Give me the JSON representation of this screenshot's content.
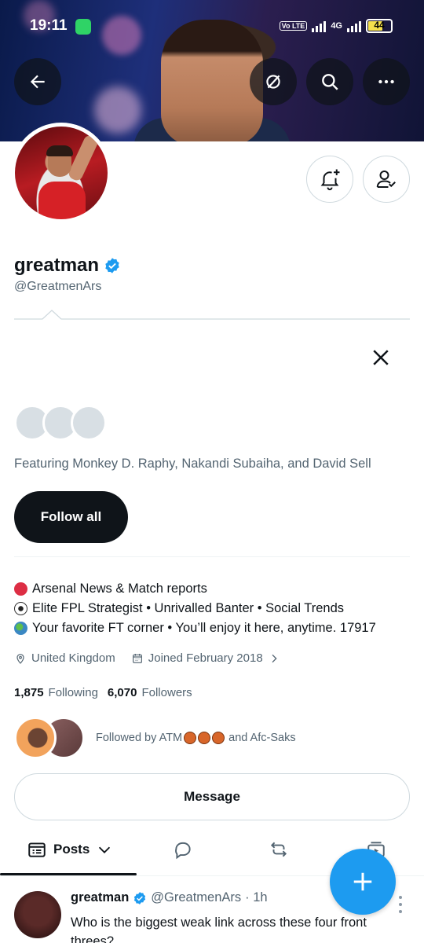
{
  "status_bar": {
    "time": "19:11",
    "network": "4G",
    "volte": "Vo LTE",
    "battery": "44"
  },
  "profile": {
    "name": "greatman",
    "handle": "@GreatmenArs",
    "verified": true,
    "verified_color": "#1d9bf0"
  },
  "suggestions": {
    "featuring_text": "Featuring Monkey D. Raphy, Nakandi Subaiha, and David Sell",
    "follow_all_label": "Follow all"
  },
  "bio": {
    "lines": [
      {
        "icon": "red-circle-icon",
        "text": "Arsenal News & Match reports"
      },
      {
        "icon": "soccer-ball-icon",
        "text": "Elite FPL Strategist • Unrivalled Banter • Social Trends"
      },
      {
        "icon": "globe-icon",
        "text": "Your favorite FT corner • You’ll enjoy it here, anytime. 17917"
      }
    ]
  },
  "meta": {
    "location": "United Kingdom",
    "joined": "Joined February 2018"
  },
  "stats": {
    "following_count": "1,875",
    "following_label": "Following",
    "followers_count": "6,070",
    "followers_label": "Followers"
  },
  "followed_by": {
    "prefix": "Followed by ATM",
    "suffix": "and Afc-Saks"
  },
  "message_label": "Message",
  "tabs": {
    "posts_label": "Posts"
  },
  "post": {
    "name": "greatman",
    "handle": "@GreatmenArs",
    "time": "· 1h",
    "text": "Who is the biggest weak link across these four front threes?"
  },
  "colors": {
    "accent": "#1d9bf0",
    "text_primary": "#0f1419",
    "text_secondary": "#536471",
    "border": "#cfd9de"
  }
}
